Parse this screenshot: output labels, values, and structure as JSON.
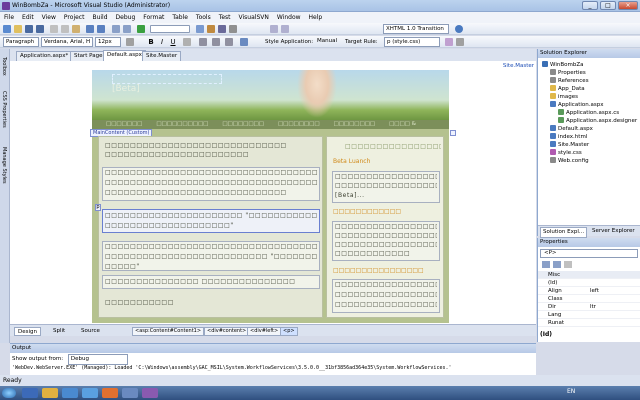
{
  "window": {
    "title": "WinBombZa - Microsoft Visual Studio (Administrator)",
    "controls": [
      "_",
      "□",
      "×"
    ]
  },
  "menu": [
    "File",
    "Edit",
    "View",
    "Project",
    "Build",
    "Debug",
    "Format",
    "Table",
    "Tools",
    "Test",
    "VisualSVN",
    "Window",
    "Help"
  ],
  "toolbar1": {
    "doctype": "XHTML 1.0 Transition"
  },
  "toolbar2": {
    "block": "Paragraph",
    "font": "Verdana, Arial, H",
    "size": "12px",
    "style_app_label": "Style Application:",
    "style_app_value": "Manual",
    "target_rule_label": "Target Rule:",
    "target_rule_value": "p (style.css)"
  },
  "side_strip": [
    "Toolbox",
    "CSS Properties",
    "Manage Styles"
  ],
  "doc_tabs": [
    {
      "label": "Application.aspx*"
    },
    {
      "label": "Start Page"
    },
    {
      "label": "Default.aspx"
    },
    {
      "label": "Site.Master"
    }
  ],
  "master_link": "Site.Master",
  "page": {
    "hero_text": "[Beta]",
    "nav_items": [
      "□□□□□□□",
      "□□□□□□□□□□",
      "□□□□□□□□",
      "□□□□□□□□",
      "□□□□□□□□",
      "□□□□ &"
    ],
    "content_badge": "MainContent (Custom)",
    "p_tag": "p",
    "main_lines": [
      "□□□□□□□□□□□□□□□□□□□□□□□□□□□□□",
      "□□□□□□□□□□□□□□□□□□□□□□□",
      "□□□□□□□□□□□□□□□□□□□□□□□□□□□□□□□□□□□",
      "□□□□□□□□□□□□□□□□□□□□□□□□□□□□□□□□□□□",
      "□□□□□□□□□□□□□□□□□□□□□□□□□□□□□",
      "□□□□□□□□□□□□□□□□□□□□□□ \"□□□□□□□□□□□□\"",
      "□□□□□□□□□□□□□□□□□□□□\"",
      "□□□□□□□□□□□□□□□□□□□□□□□□□□□□□□□□□□",
      "□□□□□□□□□□□□□□□□□□□□□□□□□□ \"□□□□□□□□",
      "□□□□□\"",
      "□□□□□□□□□□□□□□□ □□□□□□□□□□□□□□□",
      "□□□□□□□□□□□"
    ],
    "side_heading": "□□□□□□□□□□□□□□□□",
    "side_link1": "Beta Luanch",
    "side_box1": [
      "□□□□□□□□□□□□□□□□□",
      "□□□□□□□□□□□□□□□□□",
      "[Beta]..."
    ],
    "side_link2": "□□□□□□□□□□□□",
    "side_box2": [
      "□□□□□□□□□□□□□□□□□",
      "□□□□□□□□□□□□□□□□□",
      "□□□□□□□□□□□□□□□□□",
      "□□□□□□□□□□□□"
    ],
    "side_link3": "□□□□□□□□□□□□□□□□",
    "side_box3": [
      "□□□□□□□□□□□□□□□□□",
      "□□□□□□□□□□□□□□□□□",
      "□□□□□□□□□□□□□□□□□"
    ]
  },
  "design_bar": {
    "design": "Design",
    "split": "Split",
    "source": "Source",
    "crumbs": [
      "<asp:Content#Content1>",
      "<div#content>",
      "<div#left>",
      "<p>"
    ]
  },
  "output": {
    "title": "Output",
    "show_from_label": "Show output from:",
    "show_from_value": "Debug",
    "line": "'WebDev.WebServer.EXE' (Managed): Loaded 'C:\\Windows\\assembly\\GAC_MSIL\\System.WorkflowServices\\3.5.0.0__31bf3856ad364e35\\System.WorkflowServices.'"
  },
  "solution": {
    "title": "Solution Explorer",
    "items": [
      {
        "label": "WinBombZa",
        "level": 0,
        "color": "#3a6fb5"
      },
      {
        "label": "Properties",
        "level": 1,
        "color": "#8a8a8a"
      },
      {
        "label": "References",
        "level": 1,
        "color": "#8a8a8a"
      },
      {
        "label": "App_Data",
        "level": 1,
        "color": "#e0b84a"
      },
      {
        "label": "images",
        "level": 1,
        "color": "#e0b84a"
      },
      {
        "label": "Application.aspx",
        "level": 1,
        "color": "#4a7ac0"
      },
      {
        "label": "Application.aspx.cs",
        "level": 2,
        "color": "#5a9a5a"
      },
      {
        "label": "Application.aspx.designer",
        "level": 2,
        "color": "#5a9a5a"
      },
      {
        "label": "Default.aspx",
        "level": 1,
        "color": "#4a7ac0"
      },
      {
        "label": "index.html",
        "level": 1,
        "color": "#4a7ac0"
      },
      {
        "label": "Site.Master",
        "level": 1,
        "color": "#4a7ac0"
      },
      {
        "label": "style.css",
        "level": 1,
        "color": "#b05ab0"
      },
      {
        "label": "Web.config",
        "level": 1,
        "color": "#8a8a8a"
      }
    ],
    "tab1": "Solution Expl...",
    "tab2": "Server Explorer"
  },
  "properties": {
    "title": "Properties",
    "selected": "<P>",
    "rows": [
      {
        "k": "Misc",
        "v": ""
      },
      {
        "k": "(Id)",
        "v": ""
      },
      {
        "k": "Align",
        "v": "left"
      },
      {
        "k": "Class",
        "v": ""
      },
      {
        "k": "Dir",
        "v": "ltr"
      },
      {
        "k": "Lang",
        "v": ""
      },
      {
        "k": "Runat",
        "v": ""
      }
    ],
    "footer": "(Id)"
  },
  "status": "Ready",
  "taskbar": {
    "lang": "EN"
  }
}
